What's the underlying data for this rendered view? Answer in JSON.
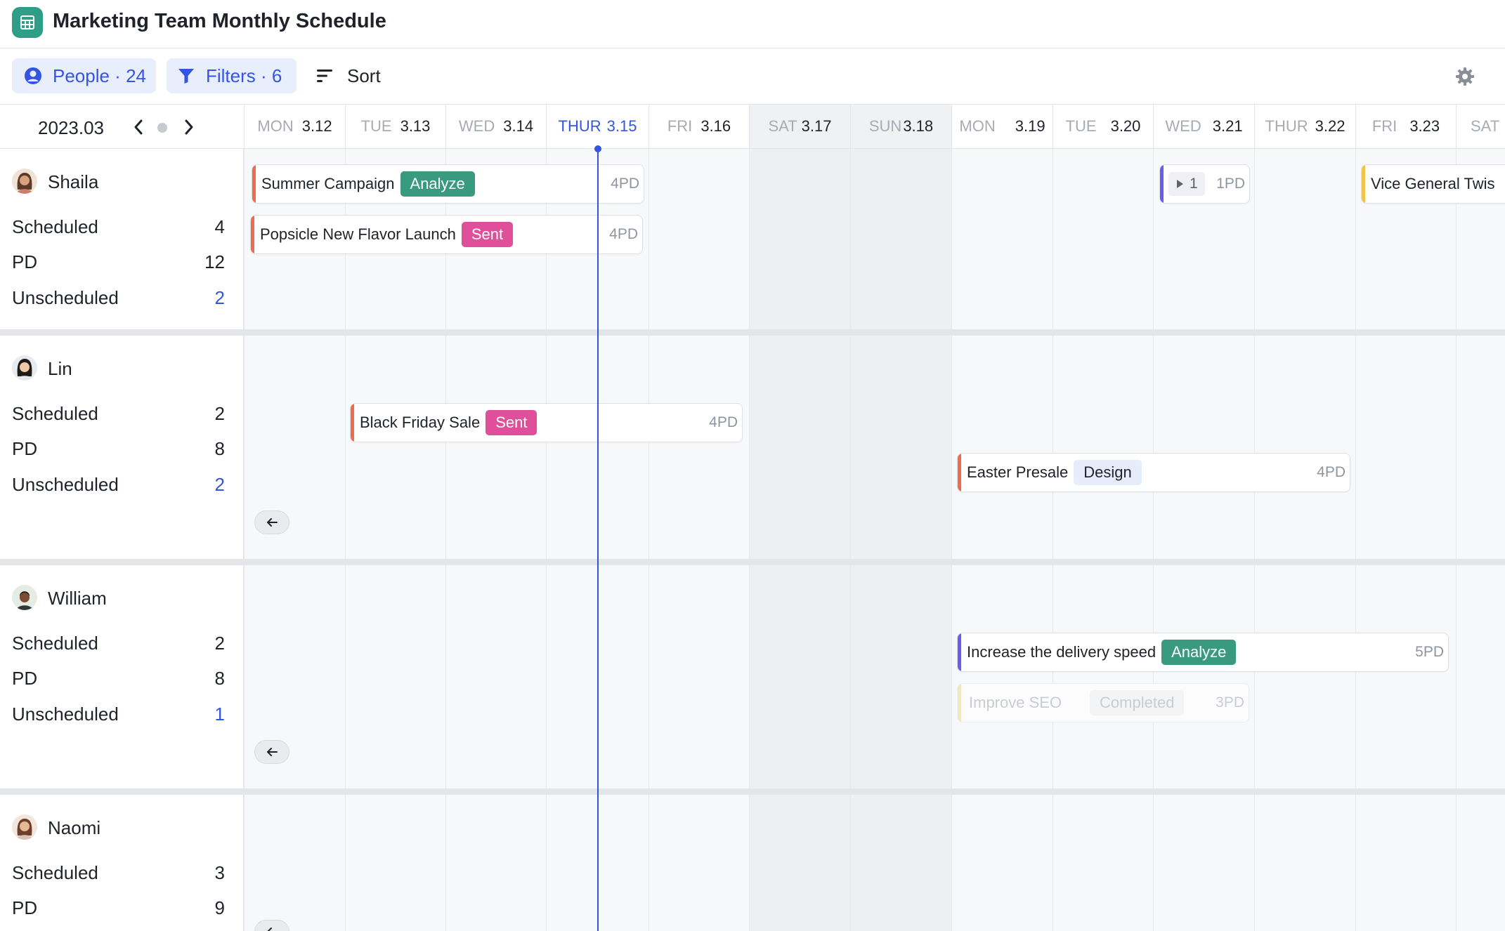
{
  "app": {
    "title": "Marketing Team Monthly Schedule"
  },
  "toolbar": {
    "people_label": "People · 24",
    "filters_label": "Filters · 6",
    "sort_label": "Sort"
  },
  "calendar": {
    "month": "2023.03",
    "days": [
      {
        "dow": "MON",
        "date": "3.12"
      },
      {
        "dow": "TUE",
        "date": "3.13"
      },
      {
        "dow": "WED",
        "date": "3.14"
      },
      {
        "dow": "THUR",
        "date": "3.15"
      },
      {
        "dow": "FRI",
        "date": "3.16"
      },
      {
        "dow": "SAT",
        "date": "3.17"
      },
      {
        "dow": "SUN",
        "date": "3.18"
      },
      {
        "dow": "MON",
        "date": "3.19"
      },
      {
        "dow": "TUE",
        "date": "3.20"
      },
      {
        "dow": "WED",
        "date": "3.21"
      },
      {
        "dow": "THUR",
        "date": "3.22"
      },
      {
        "dow": "FRI",
        "date": "3.23"
      },
      {
        "dow": "SAT",
        "date": ""
      }
    ]
  },
  "people": [
    {
      "name": "Shaila",
      "stats": [
        {
          "label": "Scheduled",
          "value": "4"
        },
        {
          "label": "PD",
          "value": "12"
        },
        {
          "label": "Unscheduled",
          "value": "2"
        }
      ]
    },
    {
      "name": "Lin",
      "stats": [
        {
          "label": "Scheduled",
          "value": "2"
        },
        {
          "label": "PD",
          "value": "8"
        },
        {
          "label": "Unscheduled",
          "value": "2"
        }
      ]
    },
    {
      "name": "William",
      "stats": [
        {
          "label": "Scheduled",
          "value": "2"
        },
        {
          "label": "PD",
          "value": "8"
        },
        {
          "label": "Unscheduled",
          "value": "1"
        }
      ]
    },
    {
      "name": "Naomi",
      "stats": [
        {
          "label": "Scheduled",
          "value": "3"
        },
        {
          "label": "PD",
          "value": "9"
        }
      ]
    }
  ],
  "tasks": [
    {
      "name": "Summer Campaign",
      "tag": "Analyze",
      "pd": "4PD"
    },
    {
      "name": "Popsicle New Flavor Launch",
      "tag": "Sent",
      "pd": "4PD"
    },
    {
      "name": "",
      "tag": "",
      "pd": "1PD",
      "count": "1"
    },
    {
      "name": "Vice General Twis",
      "tag": "",
      "pd": ""
    },
    {
      "name": "Black Friday Sale",
      "tag": "Sent",
      "pd": "4PD"
    },
    {
      "name": "Easter Presale",
      "tag": "Design",
      "pd": "4PD"
    },
    {
      "name": "Increase the delivery speed",
      "tag": "Analyze",
      "pd": "5PD"
    },
    {
      "name": "Improve SEO",
      "tag": "Completed",
      "pd": "3PD"
    }
  ],
  "colors": {
    "accent": "#3355e0",
    "app_icon": "#2f9e86",
    "analyze": "#3a9a80",
    "sent": "#df4f9a",
    "stripe_red": "#ef6a4f",
    "stripe_purple": "#6b5cf0",
    "stripe_yellow": "#f2c24a"
  },
  "icons": {
    "app": "table-grid-icon",
    "people": "user-circle-icon",
    "filters": "funnel-icon",
    "sort": "sort-lines-icon",
    "settings": "gear-icon"
  }
}
